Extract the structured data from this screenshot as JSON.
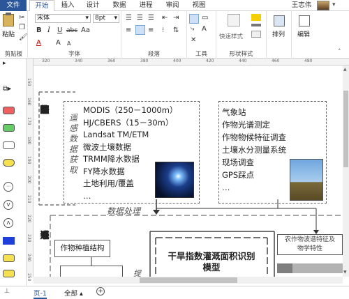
{
  "tabs": {
    "file": "文件",
    "home": "开始",
    "insert": "插入",
    "design": "设计",
    "data": "数据",
    "process": "进程",
    "review": "审阅",
    "view": "视图"
  },
  "user": {
    "name": "王志伟"
  },
  "font": {
    "name": "宋体",
    "size": "8pt"
  },
  "clipboard": {
    "paste": "粘贴",
    "label": "剪贴板"
  },
  "font_group": {
    "label": "字体",
    "bold": "B",
    "italic": "I",
    "underline": "U",
    "strike": "abc",
    "aa": "Aa",
    "a": "A",
    "grow": "A",
    "shrink": "A"
  },
  "paragraph": {
    "label": "段落"
  },
  "tools": {
    "label": "工具"
  },
  "shape_styles": {
    "quick": "快速样式",
    "label": "形状样式"
  },
  "arrange": {
    "label": "排列"
  },
  "edit": {
    "label": "编辑"
  },
  "hruler": [
    "320",
    "340",
    "360",
    "380",
    "400",
    "420",
    "440",
    "460",
    "480"
  ],
  "vruler": [
    "150",
    "160",
    "170",
    "180",
    "190",
    "200",
    "210",
    "220",
    "230",
    "240",
    "250"
  ],
  "diagram": {
    "section1_title": [
      "数",
      "据",
      "获",
      "取",
      "与",
      "野",
      "外",
      "调",
      "查"
    ],
    "remote_label": [
      "遥",
      "感",
      "数",
      "据",
      "获",
      "取"
    ],
    "remote_items": [
      "MODIS（250－1000m）",
      "HJ/CBERS（15－30m）",
      "Landsat TM/ETM",
      "微波土壤数据",
      "TRMM降水数据",
      "FY降水数据",
      "土地利用/覆盖",
      "…"
    ],
    "field_items": [
      "气象站",
      "作物光谱测定",
      "作物物候特征调查",
      "土壤水分测量系统",
      "现场调查",
      "GPS踩点",
      "…"
    ],
    "data_processing": "数据处理",
    "section2_title": [
      "灌",
      "溉",
      "遥",
      "感"
    ],
    "crop_structure": "作物种植结构",
    "model_title": [
      "干旱指数灌溉面积识别",
      "模型"
    ],
    "crop_feature": [
      "农作物波谱特征及",
      "物学特性"
    ],
    "partial_char": "提"
  },
  "status": {
    "page": "页-1",
    "all": "全部",
    "add": "+"
  }
}
